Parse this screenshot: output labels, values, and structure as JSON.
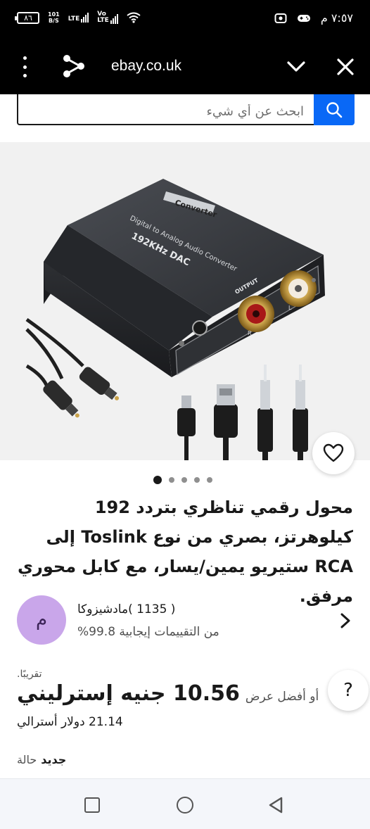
{
  "status_bar": {
    "battery": "٨٦",
    "net_speed_top": "101",
    "net_speed_bottom": "B/S",
    "network_1": "LTE",
    "network_2_top": "Vo",
    "network_2_bottom": "LTE",
    "time": "٧:٥٧ م"
  },
  "browser": {
    "url": "ebay.co.uk"
  },
  "search": {
    "placeholder": "ابحث عن أي شيء"
  },
  "gallery": {
    "image_count": 5,
    "active_index": 0,
    "device_labels": {
      "badge": "Converter",
      "line1": "Digital to Analog Audio Converter",
      "line2": "192KHz DAC",
      "output": "OUTPUT",
      "left": "L",
      "right": "R"
    }
  },
  "product": {
    "title": "محول رقمي تناظري بتردد 192 كيلوهرتز، بصري من نوع Toslink إلى RCA ستيريو يمين/يسار، مع كابل محوري مرفق."
  },
  "seller": {
    "avatar_letter": "م",
    "name": "مادشيزوكا",
    "feedback_count": "( 1135 )",
    "positive_percent": "99.8%",
    "positive_label": "من التقييمات إيجابية"
  },
  "price": {
    "approx_label": "تقريبًا.",
    "amount": "10.56 جنيه إسترليني",
    "best_offer": "أو أفضل عرض",
    "converted": "21.14 دولار أسترالي"
  },
  "condition": {
    "value": "جديد",
    "label": "حالة"
  },
  "help_button": "?",
  "colors": {
    "brand_blue": "#0968f6",
    "text_primary": "#191919",
    "text_secondary": "#505050",
    "avatar_bg": "#c9a6ea"
  },
  "icons": [
    "menu-kebab-icon",
    "share-icon",
    "chevron-down-icon",
    "close-icon",
    "search-icon",
    "heart-icon",
    "chevron-right-icon",
    "recent-apps-icon",
    "home-icon",
    "back-icon"
  ]
}
